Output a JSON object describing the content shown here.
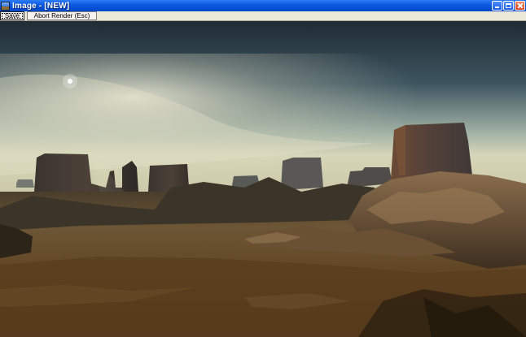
{
  "window": {
    "title": "Image - [NEW]",
    "icon": "render-image-icon",
    "controls": [
      "minimize-icon",
      "maximize-icon",
      "close-icon"
    ]
  },
  "toolbar": {
    "save_label": "Save",
    "abort_label": "Abort Render (Esc)"
  },
  "render": {
    "content": "rendered-desert-landscape",
    "colors": {
      "sky_top": "#24333d",
      "sky_horizon": "#bfc7b4",
      "ground_near": "#5a3f1f",
      "ground_far": "#7a6640"
    }
  }
}
